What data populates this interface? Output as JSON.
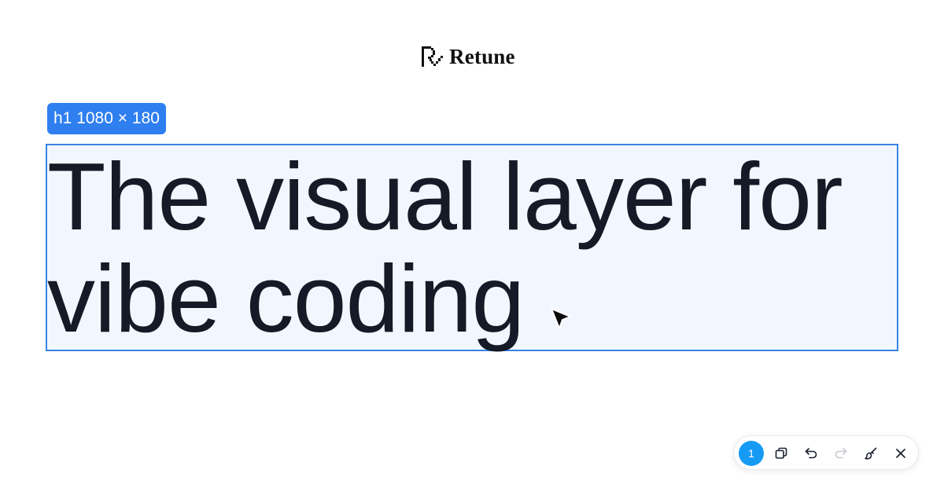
{
  "brand": {
    "name": "Retune",
    "color": "#111111"
  },
  "selection": {
    "badge_label": "h1 1080 × 180",
    "accent": "#2f7ff0"
  },
  "headline": {
    "line1": "The visual layer for",
    "line2": "vibe coding"
  },
  "toolbar": {
    "selection_count": "1",
    "badge_color": "#169bf5",
    "icons": [
      "copy-icon",
      "undo-icon",
      "redo-icon",
      "brush-icon",
      "close-icon"
    ]
  }
}
